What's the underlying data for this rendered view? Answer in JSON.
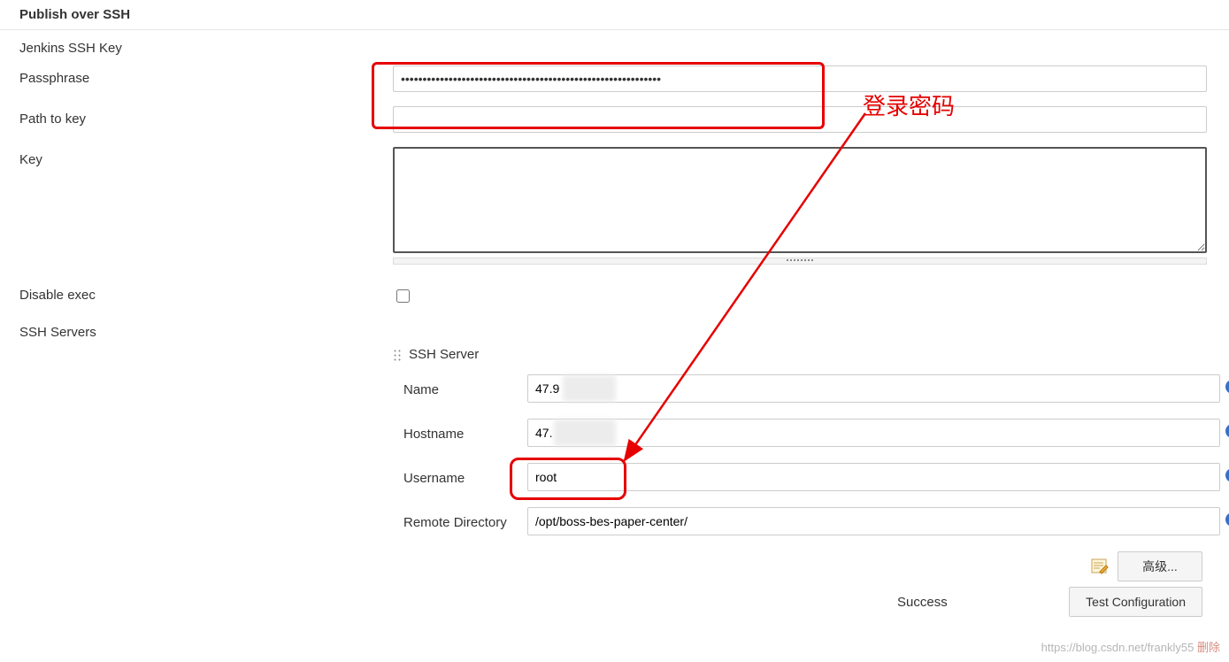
{
  "section": {
    "title": "Publish over SSH"
  },
  "labels": {
    "jenkins_ssh_key": "Jenkins SSH Key",
    "passphrase": "Passphrase",
    "path_to_key": "Path to key",
    "key": "Key",
    "disable_exec": "Disable exec",
    "ssh_servers": "SSH Servers"
  },
  "passphrase": {
    "value": "••••••••••••••••••••••••••••••••••••••••••••••••••••••••••••"
  },
  "path_to_key": {
    "value": ""
  },
  "key": {
    "value": ""
  },
  "disable_exec": {
    "checked": false
  },
  "ssh_server": {
    "header": "SSH Server",
    "name_label": "Name",
    "name_value": "47.9",
    "hostname_label": "Hostname",
    "hostname_value": "47.",
    "username_label": "Username",
    "username_value": "root",
    "remote_dir_label": "Remote Directory",
    "remote_dir_value": "/opt/boss-bes-paper-center/"
  },
  "buttons": {
    "advanced": "高级...",
    "test_configuration": "Test Configuration"
  },
  "status": {
    "success": "Success"
  },
  "annotations": {
    "login_password": "登录密码"
  },
  "watermark": {
    "text": "https://blog.csdn.net/frankly55",
    "delete": "删除"
  }
}
